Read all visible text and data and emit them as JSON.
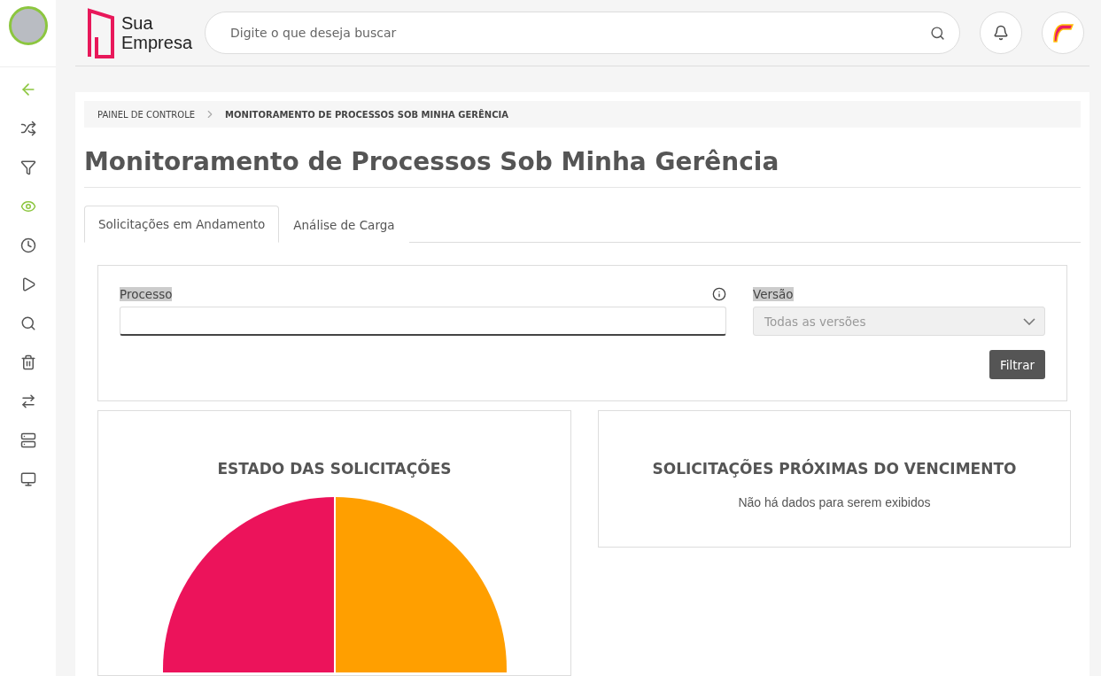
{
  "sidebar": {
    "items": [
      {
        "selected": false
      },
      {
        "selected": false
      },
      {
        "selected": true
      },
      {
        "selected": false
      },
      {
        "selected": false
      },
      {
        "selected": false
      },
      {
        "selected": false
      },
      {
        "selected": false
      },
      {
        "selected": false
      },
      {
        "selected": false
      }
    ]
  },
  "header": {
    "logo": [
      "Sua",
      "Empresa"
    ],
    "search": {
      "placeholder": "Digite o que deseja buscar"
    }
  },
  "breadcrumb": [
    "PAINEL DE CONTROLE",
    "MONITORAMENTO DE PROCESSOS SOB MINHA GERÊNCIA"
  ],
  "title": "Monitoramento de Processos Sob Minha Gerência",
  "tabs": [
    {
      "label": "Solicitações em Andamento",
      "selected": true
    },
    {
      "label": "Análise de Carga",
      "selected": false
    }
  ],
  "filter": {
    "process_label": "Processo",
    "version_label": "Versão",
    "version": {
      "value": "Todas as versões",
      "disabled": true
    },
    "button": "Filtrar"
  },
  "panels": [
    {
      "kind": "pie",
      "title": "ESTADO DAS SOLICITAÇÕES"
    },
    {
      "kind": "empty",
      "title": "SOLICITAÇÕES PRÓXIMAS DO VENCIMENTO",
      "message": "Não há dados para serem exibidos"
    }
  ]
}
